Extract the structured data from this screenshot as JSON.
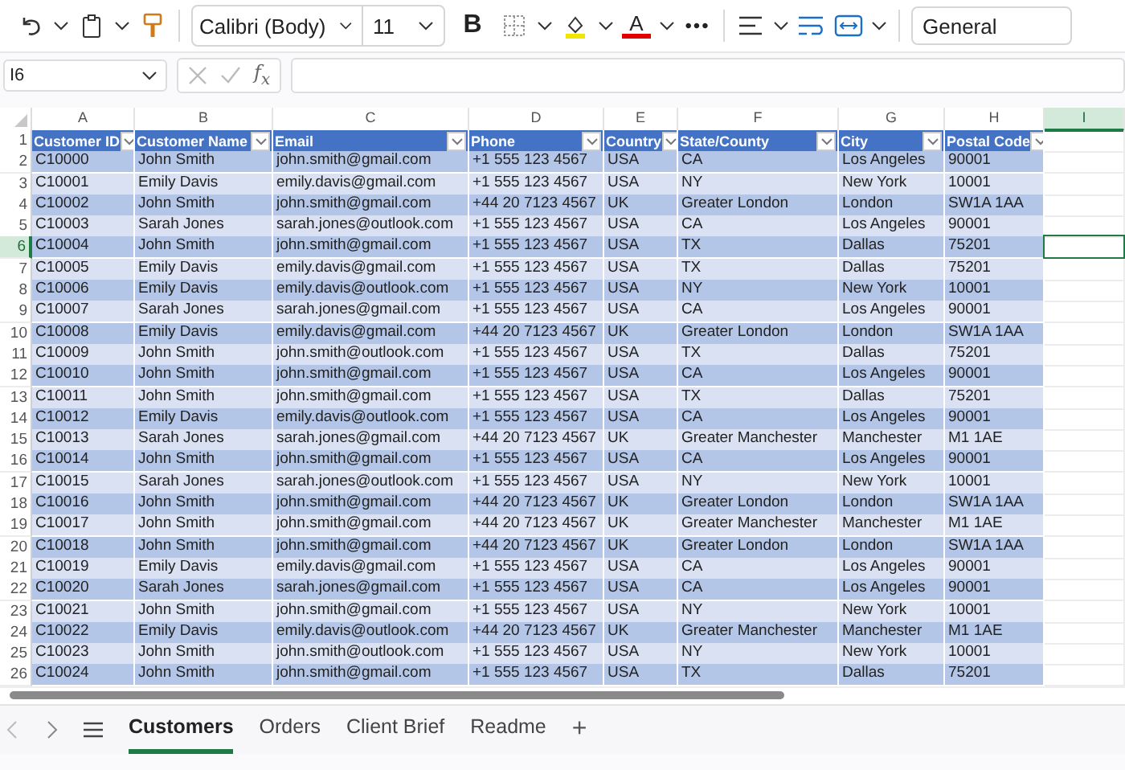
{
  "toolbar": {
    "font": "Calibri (Body)",
    "size": "11",
    "bold": "B",
    "font_color_letter": "A",
    "more": "•••",
    "number_format": "General"
  },
  "formula_bar": {
    "name_box": "I6",
    "fx": "f$_{x}$"
  },
  "columns": [
    {
      "letter": "A",
      "selected": false
    },
    {
      "letter": "B",
      "selected": false
    },
    {
      "letter": "C",
      "selected": false
    },
    {
      "letter": "D",
      "selected": false
    },
    {
      "letter": "E",
      "selected": false
    },
    {
      "letter": "F",
      "selected": false
    },
    {
      "letter": "G",
      "selected": false
    },
    {
      "letter": "H",
      "selected": false
    },
    {
      "letter": "I",
      "selected": true
    }
  ],
  "header": {
    "number": "1",
    "titles": [
      "Customer ID",
      "Customer Name",
      "Email",
      "Phone",
      "Country",
      "State/County",
      "City",
      "Postal Code"
    ]
  },
  "rows": [
    {
      "number": "2",
      "selected": false,
      "cells": [
        "C10000",
        "John Smith",
        "john.smith@gmail.com",
        "+1 555 123 4567",
        "USA",
        "CA",
        "Los Angeles",
        "90001"
      ]
    },
    {
      "number": "3",
      "selected": false,
      "cells": [
        "C10001",
        "Emily Davis",
        "emily.davis@gmail.com",
        "+1 555 123 4567",
        "USA",
        "NY",
        "New York",
        "10001"
      ]
    },
    {
      "number": "4",
      "selected": false,
      "cells": [
        "C10002",
        "John Smith",
        "john.smith@gmail.com",
        "+44 20 7123 4567",
        "UK",
        "Greater London",
        "London",
        "SW1A 1AA"
      ]
    },
    {
      "number": "5",
      "selected": false,
      "cells": [
        "C10003",
        "Sarah Jones",
        "sarah.jones@outlook.com",
        "+1 555 123 4567",
        "USA",
        "CA",
        "Los Angeles",
        "90001"
      ]
    },
    {
      "number": "6",
      "selected": true,
      "cells": [
        "C10004",
        "John Smith",
        "john.smith@gmail.com",
        "+1 555 123 4567",
        "USA",
        "TX",
        "Dallas",
        "75201"
      ]
    },
    {
      "number": "7",
      "selected": false,
      "cells": [
        "C10005",
        "Emily Davis",
        "emily.davis@gmail.com",
        "+1 555 123 4567",
        "USA",
        "TX",
        "Dallas",
        "75201"
      ]
    },
    {
      "number": "8",
      "selected": false,
      "cells": [
        "C10006",
        "Emily Davis",
        "emily.davis@outlook.com",
        "+1 555 123 4567",
        "USA",
        "NY",
        "New York",
        "10001"
      ]
    },
    {
      "number": "9",
      "selected": false,
      "cells": [
        "C10007",
        "Sarah Jones",
        "sarah.jones@gmail.com",
        "+1 555 123 4567",
        "USA",
        "CA",
        "Los Angeles",
        "90001"
      ]
    },
    {
      "number": "10",
      "selected": false,
      "cells": [
        "C10008",
        "Emily Davis",
        "emily.davis@gmail.com",
        "+44 20 7123 4567",
        "UK",
        "Greater London",
        "London",
        "SW1A 1AA"
      ]
    },
    {
      "number": "11",
      "selected": false,
      "cells": [
        "C10009",
        "John Smith",
        "john.smith@outlook.com",
        "+1 555 123 4567",
        "USA",
        "TX",
        "Dallas",
        "75201"
      ]
    },
    {
      "number": "12",
      "selected": false,
      "cells": [
        "C10010",
        "John Smith",
        "john.smith@gmail.com",
        "+1 555 123 4567",
        "USA",
        "CA",
        "Los Angeles",
        "90001"
      ]
    },
    {
      "number": "13",
      "selected": false,
      "cells": [
        "C10011",
        "John Smith",
        "john.smith@gmail.com",
        "+1 555 123 4567",
        "USA",
        "TX",
        "Dallas",
        "75201"
      ]
    },
    {
      "number": "14",
      "selected": false,
      "cells": [
        "C10012",
        "Emily Davis",
        "emily.davis@outlook.com",
        "+1 555 123 4567",
        "USA",
        "CA",
        "Los Angeles",
        "90001"
      ]
    },
    {
      "number": "15",
      "selected": false,
      "cells": [
        "C10013",
        "Sarah Jones",
        "sarah.jones@gmail.com",
        "+44 20 7123 4567",
        "UK",
        "Greater Manchester",
        "Manchester",
        "M1 1AE"
      ]
    },
    {
      "number": "16",
      "selected": false,
      "cells": [
        "C10014",
        "John Smith",
        "john.smith@gmail.com",
        "+1 555 123 4567",
        "USA",
        "CA",
        "Los Angeles",
        "90001"
      ]
    },
    {
      "number": "17",
      "selected": false,
      "cells": [
        "C10015",
        "Sarah Jones",
        "sarah.jones@outlook.com",
        "+1 555 123 4567",
        "USA",
        "NY",
        "New York",
        "10001"
      ]
    },
    {
      "number": "18",
      "selected": false,
      "cells": [
        "C10016",
        "John Smith",
        "john.smith@gmail.com",
        "+44 20 7123 4567",
        "UK",
        "Greater London",
        "London",
        "SW1A 1AA"
      ]
    },
    {
      "number": "19",
      "selected": false,
      "cells": [
        "C10017",
        "John Smith",
        "john.smith@gmail.com",
        "+44 20 7123 4567",
        "UK",
        "Greater Manchester",
        "Manchester",
        "M1 1AE"
      ]
    },
    {
      "number": "20",
      "selected": false,
      "cells": [
        "C10018",
        "John Smith",
        "john.smith@gmail.com",
        "+44 20 7123 4567",
        "UK",
        "Greater London",
        "London",
        "SW1A 1AA"
      ]
    },
    {
      "number": "21",
      "selected": false,
      "cells": [
        "C10019",
        "Emily Davis",
        "emily.davis@gmail.com",
        "+1 555 123 4567",
        "USA",
        "CA",
        "Los Angeles",
        "90001"
      ]
    },
    {
      "number": "22",
      "selected": false,
      "cells": [
        "C10020",
        "Sarah Jones",
        "sarah.jones@gmail.com",
        "+1 555 123 4567",
        "USA",
        "CA",
        "Los Angeles",
        "90001"
      ]
    },
    {
      "number": "23",
      "selected": false,
      "cells": [
        "C10021",
        "John Smith",
        "john.smith@gmail.com",
        "+1 555 123 4567",
        "USA",
        "NY",
        "New York",
        "10001"
      ]
    },
    {
      "number": "24",
      "selected": false,
      "cells": [
        "C10022",
        "Emily Davis",
        "emily.davis@outlook.com",
        "+44 20 7123 4567",
        "UK",
        "Greater Manchester",
        "Manchester",
        "M1 1AE"
      ]
    },
    {
      "number": "25",
      "selected": false,
      "cells": [
        "C10023",
        "John Smith",
        "john.smith@outlook.com",
        "+1 555 123 4567",
        "USA",
        "NY",
        "New York",
        "10001"
      ]
    },
    {
      "number": "26",
      "selected": false,
      "cells": [
        "C10024",
        "John Smith",
        "john.smith@gmail.com",
        "+1 555 123 4567",
        "USA",
        "TX",
        "Dallas",
        "75201"
      ]
    }
  ],
  "sheet_tabs": [
    {
      "label": "Customers",
      "selected": true
    },
    {
      "label": "Orders",
      "selected": false
    },
    {
      "label": "Client Brief",
      "selected": false
    },
    {
      "label": "Readme",
      "selected": false
    }
  ],
  "add_sheet": "+"
}
